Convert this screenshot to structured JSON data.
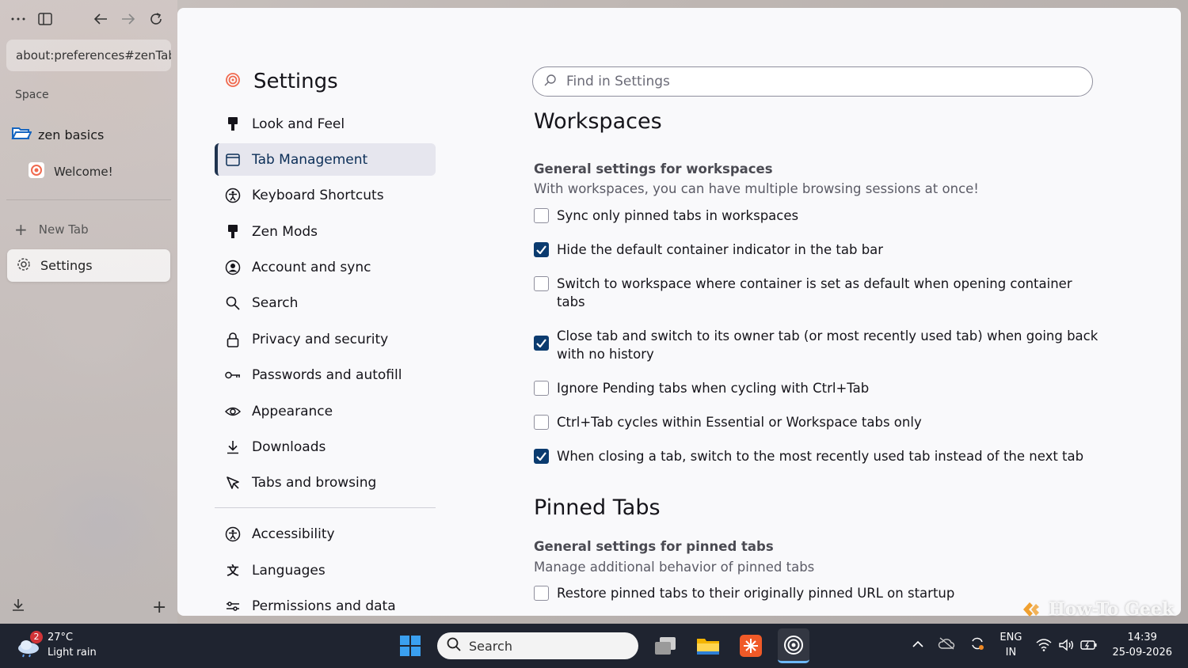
{
  "browser": {
    "url": "about:preferences#zenTabManagement",
    "space_label": "Space",
    "folder_label": "zen basics",
    "pinned_tab": "Welcome!",
    "new_tab": "New Tab",
    "active_tab": "Settings"
  },
  "settings": {
    "title": "Settings",
    "search_placeholder": "Find in Settings",
    "nav": [
      {
        "label": "Look and Feel",
        "icon": "brush-icon"
      },
      {
        "label": "Tab Management",
        "icon": "window-icon",
        "active": true
      },
      {
        "label": "Keyboard Shortcuts",
        "icon": "accessibility-icon"
      },
      {
        "label": "Zen Mods",
        "icon": "brush-icon"
      },
      {
        "label": "Account and sync",
        "icon": "account-icon"
      },
      {
        "label": "Search",
        "icon": "search-icon"
      },
      {
        "label": "Privacy and security",
        "icon": "lock-icon"
      },
      {
        "label": "Passwords and autofill",
        "icon": "key-icon"
      },
      {
        "label": "Appearance",
        "icon": "eye-icon"
      },
      {
        "label": "Downloads",
        "icon": "download-icon"
      },
      {
        "label": "Tabs and browsing",
        "icon": "cursor-icon"
      }
    ],
    "nav_secondary": [
      {
        "label": "Accessibility",
        "icon": "accessibility-icon"
      },
      {
        "label": "Languages",
        "icon": "translate-icon"
      },
      {
        "label": "Permissions and data",
        "icon": "sliders-icon"
      }
    ],
    "workspaces": {
      "heading": "Workspaces",
      "sub_title": "General settings for workspaces",
      "description": "With workspaces, you can have multiple browsing sessions at once!",
      "options": [
        {
          "label": "Sync only pinned tabs in workspaces",
          "checked": false
        },
        {
          "label": "Hide the default container indicator in the tab bar",
          "checked": true
        },
        {
          "label": "Switch to workspace where container is set as default when opening container tabs",
          "checked": false
        },
        {
          "label": "Close tab and switch to its owner tab (or most recently used tab) when going back with no history",
          "checked": true
        },
        {
          "label": "Ignore Pending tabs when cycling with Ctrl+Tab",
          "checked": false
        },
        {
          "label": "Ctrl+Tab cycles within Essential or Workspace tabs only",
          "checked": false
        },
        {
          "label": "When closing a tab, switch to the most recently used tab instead of the next tab",
          "checked": true
        }
      ]
    },
    "pinned": {
      "heading": "Pinned Tabs",
      "sub_title": "General settings for pinned tabs",
      "description": "Manage additional behavior of pinned tabs",
      "options": [
        {
          "label": "Restore pinned tabs to their originally pinned URL on startup",
          "checked": false
        }
      ]
    }
  },
  "watermark": "How-To Geek",
  "taskbar": {
    "weather_badge": "2",
    "temperature": "27°C",
    "condition": "Light rain",
    "search_label": "Search",
    "lang_top": "ENG",
    "lang_bottom": "IN",
    "time": "14:39",
    "date": "25-09-2026"
  },
  "colors": {
    "accent": "#0b3b6f",
    "active_nav_bg": "#e6e6ee",
    "taskbar_bg": "#1f2430"
  }
}
